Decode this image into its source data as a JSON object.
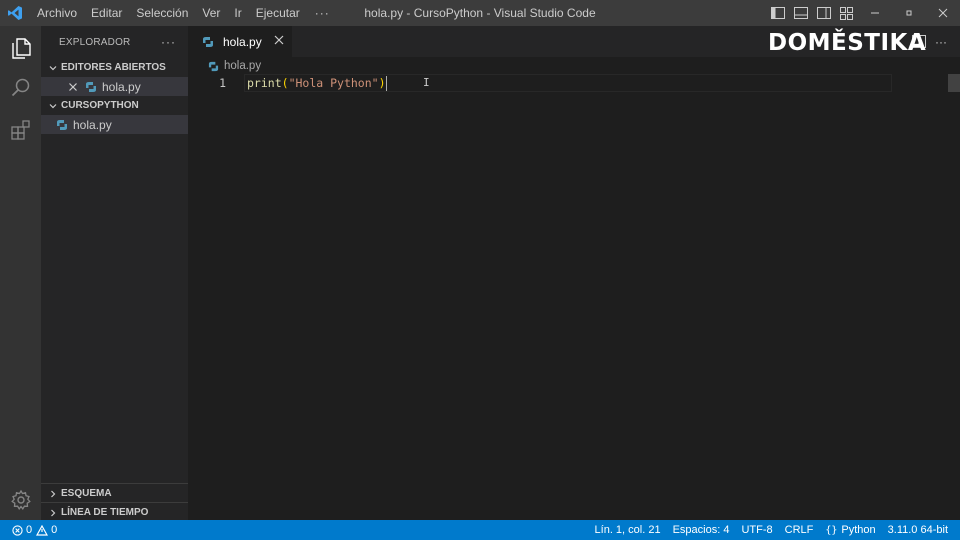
{
  "window": {
    "title": "hola.py - CursoPython - Visual Studio Code"
  },
  "menu": {
    "items": [
      "Archivo",
      "Editar",
      "Selección",
      "Ver",
      "Ir",
      "Ejecutar"
    ],
    "more": "···"
  },
  "sidebar": {
    "title": "EXPLORADOR",
    "more": "···",
    "open_editors": {
      "label": "EDITORES ABIERTOS",
      "file": "hola.py"
    },
    "workspace": {
      "label": "CURSOPYTHON",
      "file": "hola.py"
    },
    "outline": "ESQUEMA",
    "timeline": "LÍNEA DE TIEMPO"
  },
  "editor": {
    "tab_label": "hola.py",
    "breadcrumb": "hola.py",
    "line_number": "1",
    "code": {
      "fn": "print",
      "open": "(",
      "string": "\"Hola Python\"",
      "close": ")"
    },
    "tab_more": "···"
  },
  "watermark": "DOMĚSTIKA",
  "statusbar": {
    "errors": "0",
    "warnings": "0",
    "position": "Lín. 1, col. 21",
    "spaces": "Espacios: 4",
    "encoding": "UTF-8",
    "eol": "CRLF",
    "language": "Python",
    "interpreter": "3.11.0 64-bit"
  },
  "colors": {
    "titlebar": "#3c3c3c",
    "activitybar": "#333333",
    "sidebar": "#252526",
    "editor": "#1e1e1e",
    "statusbar": "#007acc",
    "python_icon": "#519aba"
  }
}
